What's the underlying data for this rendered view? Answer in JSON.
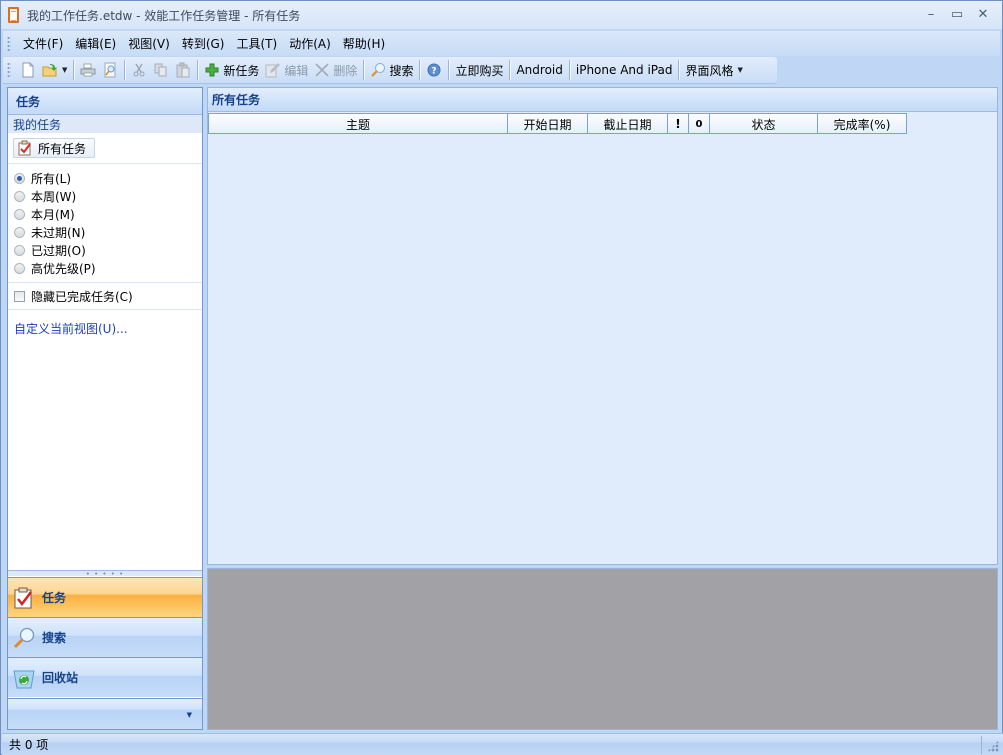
{
  "window": {
    "title": "我的工作任务.etdw - 效能工作任务管理 - 所有任务",
    "controls": {
      "minimize": "–",
      "maximize": "▭",
      "close": "✕"
    }
  },
  "menu": [
    {
      "label": "文件(F)"
    },
    {
      "label": "编辑(E)"
    },
    {
      "label": "视图(V)"
    },
    {
      "label": "转到(G)"
    },
    {
      "label": "工具(T)"
    },
    {
      "label": "动作(A)"
    },
    {
      "label": "帮助(H)"
    }
  ],
  "toolbar": {
    "new_task": "新任务",
    "edit": "编辑",
    "delete": "删除",
    "search": "搜索",
    "buy_now": "立即购买",
    "android": "Android",
    "iphone_ipad": "iPhone And iPad",
    "ui_style": "界面风格"
  },
  "left_pane": {
    "header": "任务",
    "section_title": "我的任务",
    "all_tasks_button": "所有任务",
    "filters": [
      {
        "label": "所有(L)",
        "checked": true
      },
      {
        "label": "本周(W)",
        "checked": false
      },
      {
        "label": "本月(M)",
        "checked": false
      },
      {
        "label": "未过期(N)",
        "checked": false
      },
      {
        "label": "已过期(O)",
        "checked": false
      },
      {
        "label": "高优先级(P)",
        "checked": false
      }
    ],
    "hide_completed": {
      "label": "隐藏已完成任务(C)",
      "checked": false
    },
    "customize_view_link": "自定义当前视图(U)...",
    "nav_buttons": [
      {
        "label": "任务",
        "icon": "clipboard-check-icon",
        "active": true
      },
      {
        "label": "搜索",
        "icon": "magnifier-icon",
        "active": false
      },
      {
        "label": "回收站",
        "icon": "recycle-bin-icon",
        "active": false
      }
    ]
  },
  "right_pane": {
    "header": "所有任务",
    "columns": [
      {
        "label": "主题"
      },
      {
        "label": "开始日期"
      },
      {
        "label": "截止日期"
      },
      {
        "label": "!"
      },
      {
        "label": "0"
      },
      {
        "label": "状态"
      },
      {
        "label": "完成率(%)"
      }
    ],
    "rows": []
  },
  "statusbar": {
    "text": "共 0 项"
  },
  "colors": {
    "accent_text": "#15428b",
    "active_nav": "#fbb042",
    "preview_bg": "#a2a1a6",
    "link": "#1a3fb8"
  }
}
